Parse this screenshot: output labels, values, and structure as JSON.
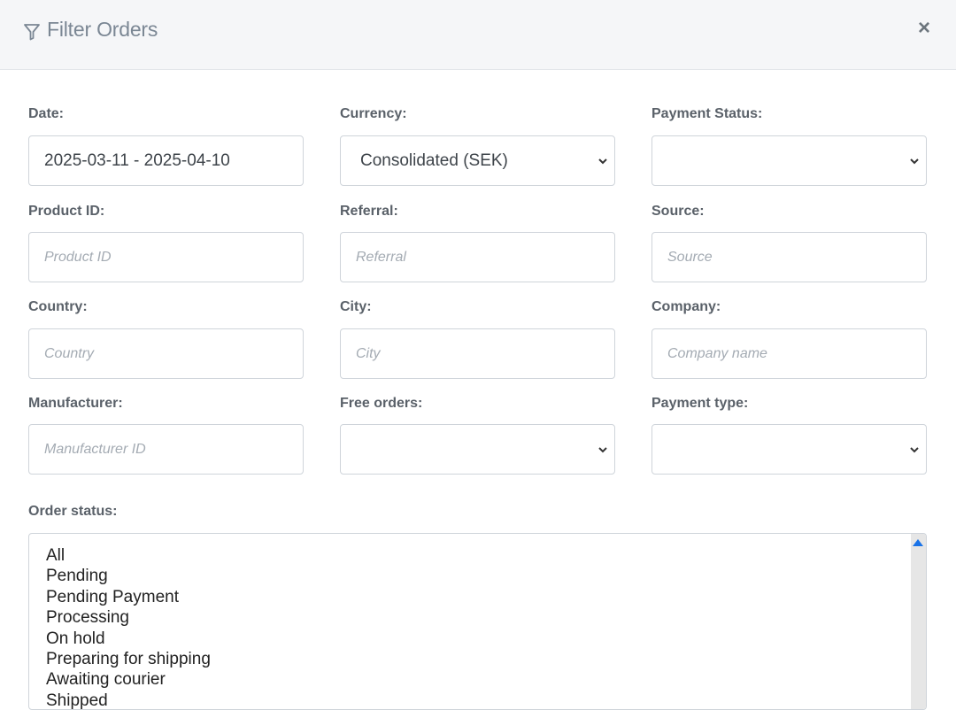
{
  "header": {
    "title": "Filter Orders"
  },
  "fields": {
    "date": {
      "label": "Date:",
      "value": "2025-03-11 - 2025-04-10"
    },
    "currency": {
      "label": "Currency:",
      "value": "Consolidated (SEK)"
    },
    "payment_status": {
      "label": "Payment Status:",
      "value": ""
    },
    "product_id": {
      "label": "Product ID:",
      "placeholder": "Product ID"
    },
    "referral": {
      "label": "Referral:",
      "placeholder": "Referral"
    },
    "source": {
      "label": "Source:",
      "placeholder": "Source"
    },
    "country": {
      "label": "Country:",
      "placeholder": "Country"
    },
    "city": {
      "label": "City:",
      "placeholder": "City"
    },
    "company": {
      "label": "Company:",
      "placeholder": "Company name"
    },
    "manufacturer": {
      "label": "Manufacturer:",
      "placeholder": "Manufacturer ID"
    },
    "free_orders": {
      "label": "Free orders:",
      "value": ""
    },
    "payment_type": {
      "label": "Payment type:",
      "value": ""
    }
  },
  "order_status": {
    "label": "Order status:",
    "options": [
      "All",
      "Pending",
      "Pending Payment",
      "Processing",
      "On hold",
      "Preparing for shipping",
      "Awaiting courier",
      "Shipped"
    ]
  },
  "colors": {
    "header_bg": "#f5f6f8",
    "border": "#cfd4da",
    "scroll_arrow": "#1a73e8"
  }
}
